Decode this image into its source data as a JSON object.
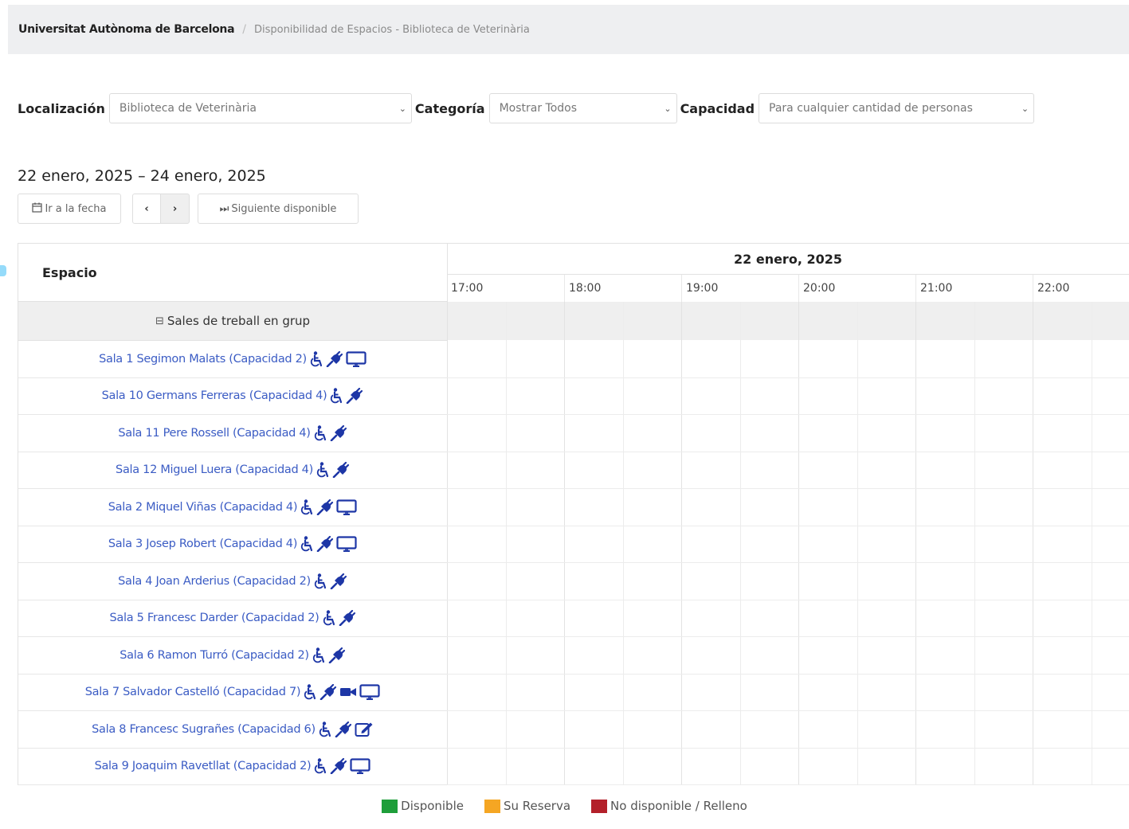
{
  "breadcrumb": {
    "home": "Universitat Autònoma de Barcelona",
    "separator": "/",
    "current": "Disponibilidad de Espacios - Biblioteca de Veterinària"
  },
  "filters": {
    "location_label": "Localización",
    "location_value": "Biblioteca de Veterinària",
    "category_label": "Categoría",
    "category_value": "Mostrar Todos",
    "capacity_label": "Capacidad",
    "capacity_value": "Para cualquier cantidad de personas"
  },
  "date_range": "22 enero, 2025 – 24 enero, 2025",
  "toolbar": {
    "goto_date_label": "Ir a la fecha",
    "goto_date_icon": "calendar-icon",
    "prev_label": "‹",
    "next_label": "›",
    "next_available_label": "Siguiente disponible",
    "next_available_icon": "fast-forward-icon"
  },
  "grid": {
    "space_header": "Espacio",
    "date_header": "22 enero, 2025",
    "hours": [
      "17:00",
      "18:00",
      "19:00",
      "20:00",
      "21:00",
      "22:00"
    ],
    "group": {
      "collapse_symbol": "⊟",
      "label": "Sales de treball en grup"
    },
    "rooms": [
      {
        "label": "Sala 1 Segimon Malats (Capacidad 2)",
        "icons": [
          "wheelchair-icon",
          "plug-icon",
          "monitor-icon"
        ]
      },
      {
        "label": "Sala 10 Germans Ferreras (Capacidad 4)",
        "icons": [
          "wheelchair-icon",
          "plug-icon"
        ]
      },
      {
        "label": "Sala 11 Pere Rossell (Capacidad 4)",
        "icons": [
          "wheelchair-icon",
          "plug-icon"
        ]
      },
      {
        "label": "Sala 12 Miguel Luera (Capacidad 4)",
        "icons": [
          "wheelchair-icon",
          "plug-icon"
        ]
      },
      {
        "label": "Sala 2 Miquel Viñas (Capacidad 4)",
        "icons": [
          "wheelchair-icon",
          "plug-icon",
          "monitor-icon"
        ]
      },
      {
        "label": "Sala 3 Josep Robert (Capacidad 4)",
        "icons": [
          "wheelchair-icon",
          "plug-icon",
          "monitor-icon"
        ]
      },
      {
        "label": "Sala 4 Joan Arderius (Capacidad 2)",
        "icons": [
          "wheelchair-icon",
          "plug-icon"
        ]
      },
      {
        "label": "Sala 5 Francesc Darder (Capacidad 2)",
        "icons": [
          "wheelchair-icon",
          "plug-icon"
        ]
      },
      {
        "label": "Sala 6 Ramon Turró (Capacidad 2)",
        "icons": [
          "wheelchair-icon",
          "plug-icon"
        ]
      },
      {
        "label": "Sala 7 Salvador Castelló (Capacidad 7)",
        "icons": [
          "wheelchair-icon",
          "plug-icon",
          "video-camera-icon",
          "monitor-icon"
        ]
      },
      {
        "label": "Sala 8 Francesc Sugrañes (Capacidad 6)",
        "icons": [
          "wheelchair-icon",
          "plug-icon",
          "whiteboard-icon"
        ]
      },
      {
        "label": "Sala 9 Joaquim Ravetllat (Capacidad 2)",
        "icons": [
          "wheelchair-icon",
          "plug-icon",
          "monitor-icon"
        ]
      }
    ]
  },
  "legend": [
    {
      "label": "Disponible",
      "color": "#1e9e3a"
    },
    {
      "label": "Su Reserva",
      "color": "#f5a623"
    },
    {
      "label": "No disponible / Relleno",
      "color": "#b3202a"
    }
  ],
  "colors": {
    "link": "#3b5cc4",
    "icon": "#1d36a6",
    "header_bg": "#eeeff1"
  }
}
